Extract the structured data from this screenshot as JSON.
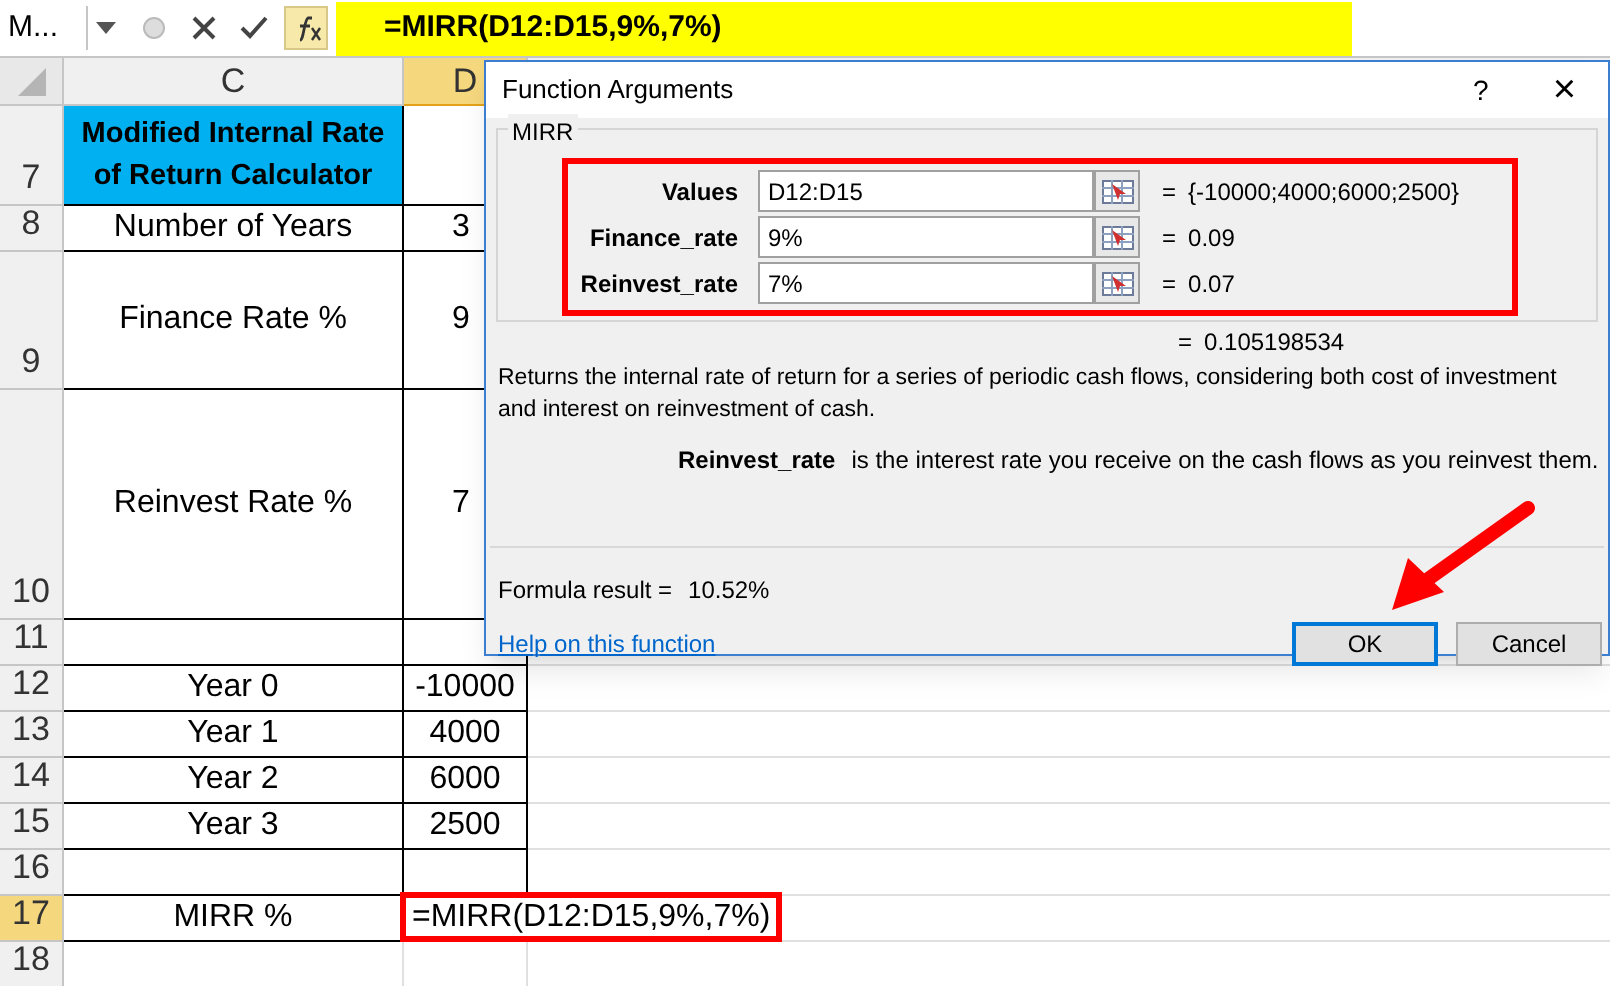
{
  "name_box": "M...",
  "formula_bar": {
    "value": "=MIRR(D12:D15,9%,7%)"
  },
  "columns": [
    {
      "label": "C",
      "selected": false
    },
    {
      "label": "D",
      "selected": true
    }
  ],
  "rows": [
    {
      "number": "7",
      "selected": false,
      "kind": "title",
      "cells": [
        "Modified Internal Rate of Return Calculator",
        ""
      ]
    },
    {
      "number": "8",
      "selected": false,
      "kind": "data",
      "cells": [
        "Number of Years",
        "3"
      ]
    },
    {
      "number": "9",
      "selected": false,
      "kind": "data",
      "cells": [
        "Finance Rate %",
        "9"
      ]
    },
    {
      "number": "10",
      "selected": false,
      "kind": "data",
      "cells": [
        "Reinvest Rate %",
        "7"
      ]
    },
    {
      "number": "11",
      "selected": false,
      "kind": "data",
      "cells": [
        "",
        ""
      ]
    },
    {
      "number": "12",
      "selected": false,
      "kind": "data",
      "cells": [
        "Year 0",
        "-10000"
      ]
    },
    {
      "number": "13",
      "selected": false,
      "kind": "data",
      "cells": [
        "Year 1",
        "4000"
      ]
    },
    {
      "number": "14",
      "selected": false,
      "kind": "data",
      "cells": [
        "Year 2",
        "6000"
      ]
    },
    {
      "number": "15",
      "selected": false,
      "kind": "data",
      "cells": [
        "Year 3",
        "2500"
      ]
    },
    {
      "number": "16",
      "selected": false,
      "kind": "data",
      "cells": [
        "",
        ""
      ]
    },
    {
      "number": "17",
      "selected": true,
      "kind": "formula",
      "cells": [
        "MIRR %",
        "=MIRR(D12:D15,9%,7%)"
      ]
    },
    {
      "number": "18",
      "selected": false,
      "kind": "blank",
      "cells": []
    }
  ],
  "dialog": {
    "title": "Function Arguments",
    "help": "?",
    "close": "×",
    "group": "MIRR",
    "arguments": [
      {
        "label": "Values",
        "value": "D12:D15",
        "sign": "=",
        "result": "{-10000;4000;6000;2500}"
      },
      {
        "label": "Finance_rate",
        "value": "9%",
        "sign": "=",
        "result": "0.09"
      },
      {
        "label": "Reinvest_rate",
        "value": "7%",
        "sign": "=",
        "result": "0.07"
      }
    ],
    "total": {
      "sign": "=",
      "value": "0.105198534"
    },
    "description": "Returns the internal rate of return for a series of periodic cash flows, considering both cost of investment and interest on reinvestment of cash.",
    "argument_help": {
      "name": "Reinvest_rate",
      "text": "is the interest rate you receive on the cash flows as you reinvest them."
    },
    "formula_result": {
      "label": "Formula result =",
      "value": "10.52%"
    },
    "help_link": "Help on this function",
    "buttons": [
      {
        "label": "OK",
        "selected": true
      },
      {
        "label": "Cancel",
        "selected": false
      }
    ]
  }
}
